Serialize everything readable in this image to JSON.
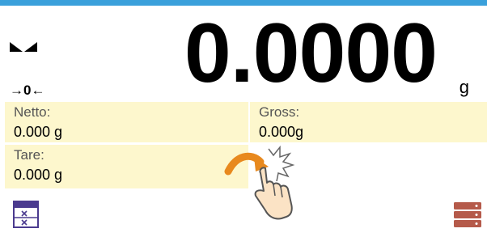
{
  "display": {
    "main_value": "0.0000",
    "unit": "g",
    "zero_indicator": "→0←",
    "stable_icon": "stable-indicator-icon"
  },
  "fields": {
    "netto": {
      "label": "Netto:",
      "value": "0.000 g"
    },
    "gross": {
      "label": "Gross:",
      "value": "0.000g"
    },
    "tare": {
      "label": "Tare:",
      "value": "0.000 g"
    }
  },
  "icons": {
    "left_button": "tare-database-icon",
    "right_button": "database-icon",
    "gesture": "tap-hand-icon"
  },
  "colors": {
    "accent": "#3aa0db",
    "field_bg": "#fdf7cd",
    "icon_purple": "#4b3b8f",
    "icon_red": "#b55a4a"
  }
}
